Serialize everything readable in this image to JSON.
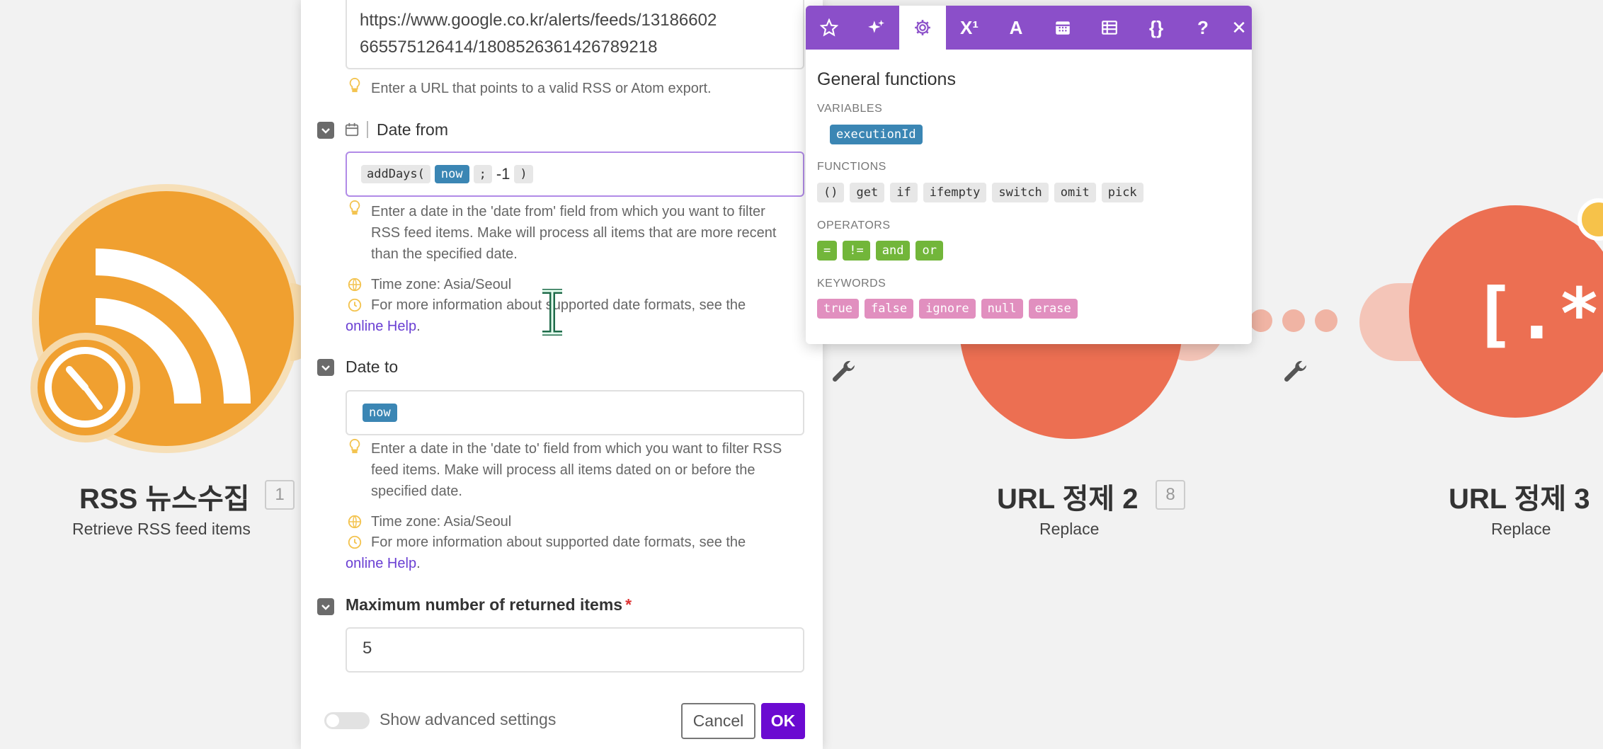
{
  "canvas": {
    "rss_node": {
      "title": "RSS 뉴스수집",
      "badge": "1",
      "subtitle": "Retrieve RSS feed items"
    },
    "url2_node": {
      "title": "URL 정제 2",
      "badge": "8",
      "subtitle": "Replace"
    },
    "url3_node": {
      "title": "URL 정제 3",
      "subtitle": "Replace",
      "glyph": "[.*]"
    }
  },
  "panel": {
    "url_field": {
      "value_line1": "https://www.google.co.kr/alerts/feeds/13186602",
      "value_line2": "665575126414/1808526361426789218",
      "help": "Enter a URL that points to a valid RSS or Atom export."
    },
    "date_from": {
      "label": "Date from",
      "expr_fn": "addDays(",
      "expr_var": "now",
      "expr_sep": ";",
      "expr_arg": "-1",
      "expr_close": ")",
      "help_line1": "Enter a date in the 'date from' field from which you want to filter",
      "help_line2": "RSS feed items. Make will process all items that are more recent",
      "help_line3": "than the specified date.",
      "tz": "Time zone: Asia/Seoul",
      "info_line1": "For more information about supported date formats, see the",
      "info_link": "online Help",
      "info_end": "."
    },
    "date_to": {
      "label": "Date to",
      "expr_var": "now",
      "help_line1": "Enter a date in the 'date to' field from which you want to filter RSS",
      "help_line2": "feed items. Make will process all items dated on or before the",
      "help_line3": "specified date.",
      "tz": "Time zone: Asia/Seoul",
      "info_line1": "For more information about supported date formats, see the",
      "info_link": "online Help",
      "info_end": "."
    },
    "max_items": {
      "label": "Maximum number of returned items",
      "required_mark": "*",
      "value": "5"
    },
    "footer": {
      "advanced_label": "Show advanced settings",
      "cancel_label": "Cancel",
      "ok_label": "OK"
    }
  },
  "popup": {
    "tabs": [
      {
        "icon": "star-icon"
      },
      {
        "icon": "sparkle-icon"
      },
      {
        "icon": "gear-icon",
        "active": true
      },
      {
        "icon": "superscript-icon",
        "text": "X¹"
      },
      {
        "icon": "text-icon",
        "text": "A"
      },
      {
        "icon": "calendar-icon"
      },
      {
        "icon": "table-icon"
      },
      {
        "icon": "braces-icon",
        "text": "{}"
      },
      {
        "icon": "help-icon",
        "text": "?"
      },
      {
        "icon": "close-icon",
        "text": "✕"
      }
    ],
    "title": "General functions",
    "variables_label": "VARIABLES",
    "variables": [
      "executionId"
    ],
    "functions_label": "FUNCTIONS",
    "functions": [
      "()",
      "get",
      "if",
      "ifempty",
      "switch",
      "omit",
      "pick"
    ],
    "operators_label": "OPERATORS",
    "operators": [
      "=",
      "!=",
      "and",
      "or"
    ],
    "keywords_label": "KEYWORDS",
    "keywords": [
      "true",
      "false",
      "ignore",
      "null",
      "erase"
    ]
  },
  "colors": {
    "brand_purple": "#6b0ad1",
    "popup_header": "#8b4fc9",
    "rss_orange": "#f0a030",
    "node_red": "#ec6f52",
    "variable_blue": "#3b86b4",
    "operator_green": "#72b63a",
    "keyword_pink": "#e18fbf"
  }
}
